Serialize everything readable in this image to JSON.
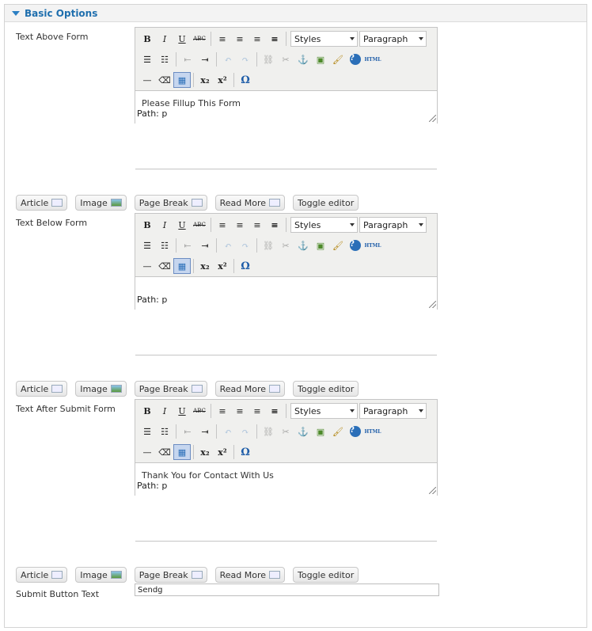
{
  "header": {
    "title": "Basic Options"
  },
  "editors": [
    {
      "label": "Text Above Form",
      "content": "Please Fillup This Form",
      "path": "Path: p"
    },
    {
      "label": "Text Below Form",
      "content": "",
      "path": "Path: p"
    },
    {
      "label": "Text After Submit Form",
      "content": "Thank You for Contact With Us",
      "path": "Path: p"
    }
  ],
  "toolbar": {
    "styles": "Styles",
    "format": "Paragraph",
    "html_label": "HTML"
  },
  "buttons": {
    "article": "Article",
    "image": "Image",
    "page_break": "Page Break",
    "read_more": "Read More",
    "toggle_editor": "Toggle editor"
  },
  "submit": {
    "label": "Submit Button Text",
    "value": "Sendg"
  },
  "colors": {
    "accent": "#1f6fae"
  }
}
